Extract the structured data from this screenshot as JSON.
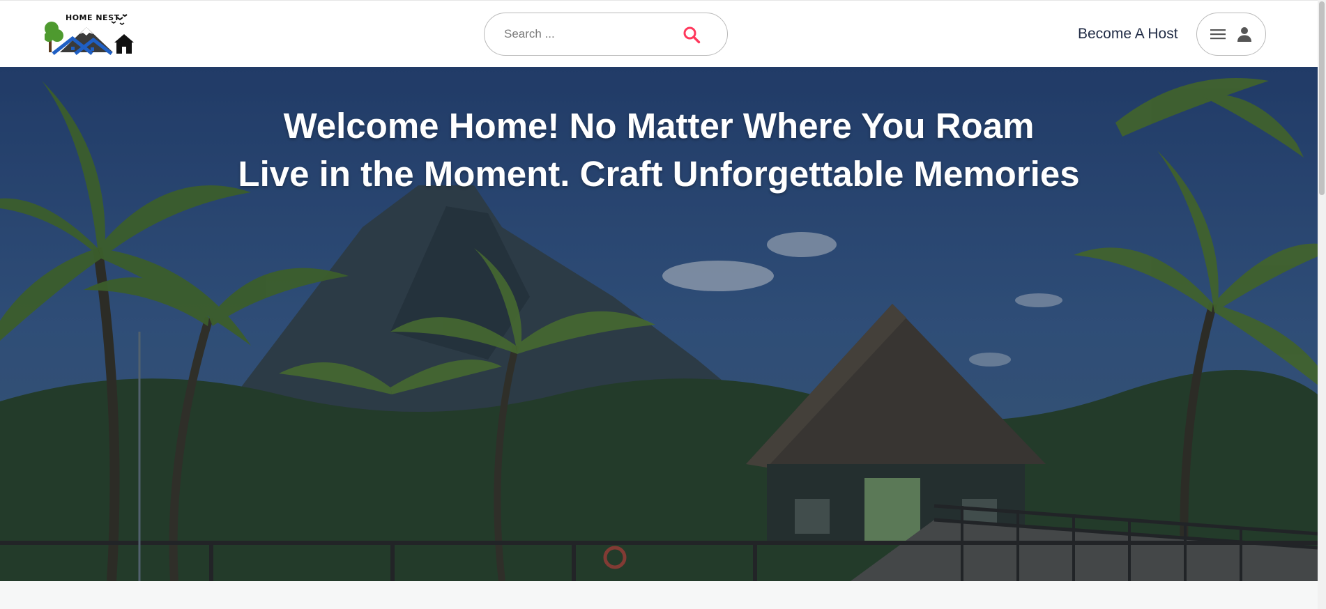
{
  "header": {
    "logo_text": "HOME  NEST",
    "search": {
      "placeholder": "Search ..."
    },
    "host_link": "Become A Host"
  },
  "hero": {
    "line1": "Welcome Home! No Matter Where You Roam",
    "line2": "Live in the Moment. Craft Unforgettable Memories"
  },
  "icons": {
    "search": "search-icon",
    "menu": "hamburger-menu-icon",
    "user": "user-avatar-icon"
  },
  "colors": {
    "accent": "#ff385c",
    "text_dark": "#1f2a44",
    "hero_text": "#ffffff"
  }
}
